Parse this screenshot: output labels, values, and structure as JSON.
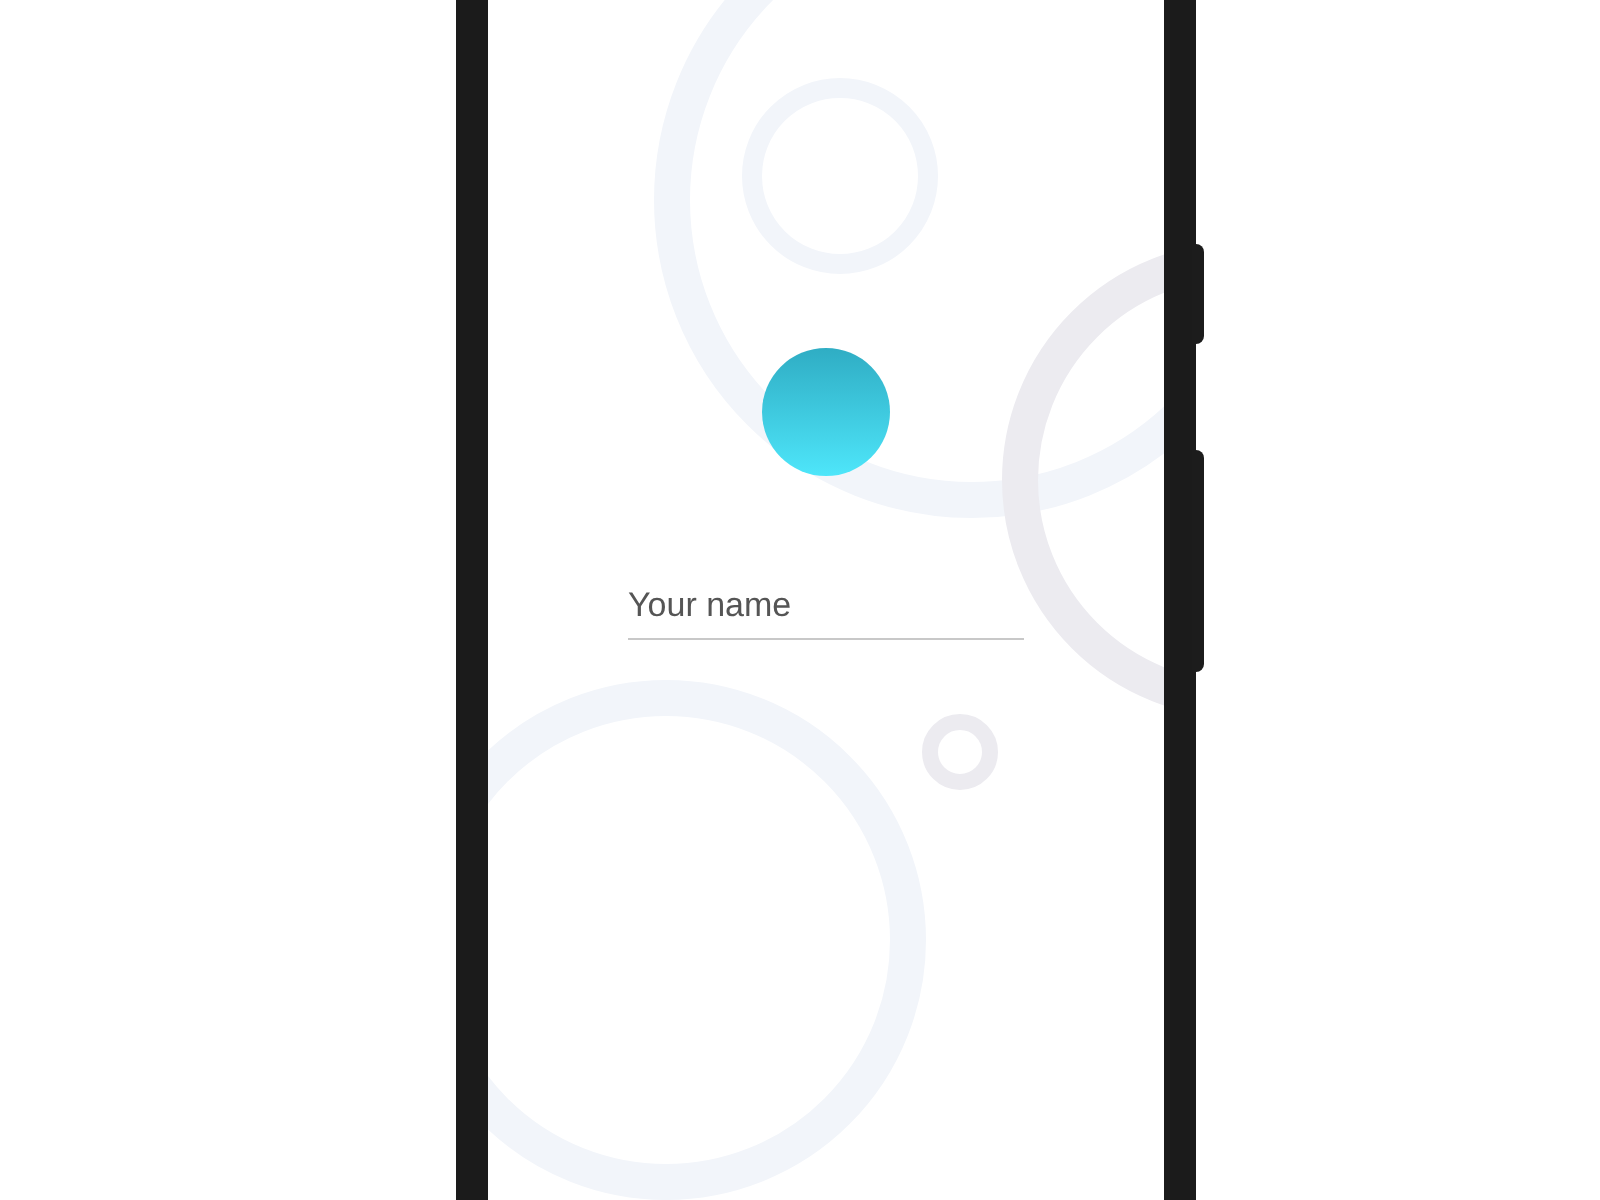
{
  "name_field": {
    "placeholder": "Your name"
  }
}
